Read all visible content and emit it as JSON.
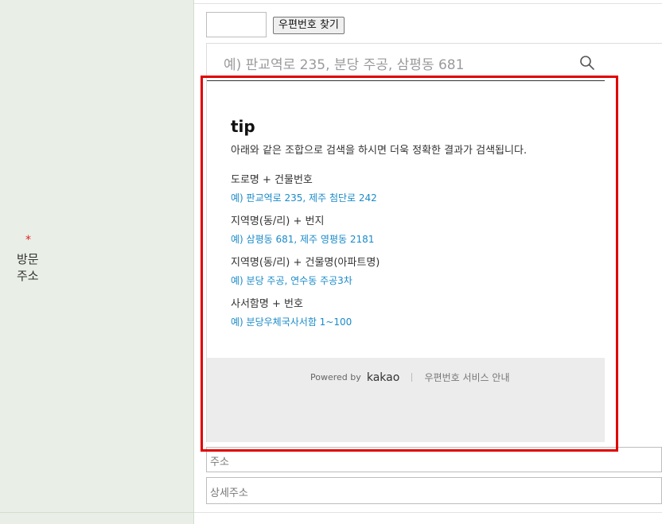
{
  "form": {
    "required_mark": "*",
    "field_label_line1": "방문",
    "field_label_line2": "주소",
    "zip_button": "우편번호 찾기"
  },
  "postcode": {
    "search_placeholder": "예) 판교역로 235, 분당 주공, 삼평동 681",
    "tip": {
      "title": "tip",
      "description": "아래와 같은 조합으로 검색을 하시면 더욱 정확한 결과가 검색됩니다.",
      "items": [
        {
          "heading": "도로명 + 건물번호",
          "example": "예) 판교역로 235,  제주 첨단로 242"
        },
        {
          "heading": "지역명(동/리) + 번지",
          "example": "예) 삼평동 681,  제주 영평동 2181"
        },
        {
          "heading": "지역명(동/리) + 건물명(아파트명)",
          "example": "예) 분당 주공,  연수동 주공3차"
        },
        {
          "heading": "사서함명 + 번호",
          "example": "예) 분당우체국사서함 1~100"
        }
      ]
    },
    "footer": {
      "powered_by": "Powered by",
      "logo": "kakao",
      "service_link": "우편번호 서비스 안내"
    }
  },
  "address_field": {
    "placeholder": "주소"
  },
  "detail_field": {
    "placeholder": "상세주소"
  },
  "colors": {
    "label_background": "#e9efe6",
    "highlight": "#e00000",
    "example_text": "#1a8bc9",
    "required": "#e02020"
  }
}
